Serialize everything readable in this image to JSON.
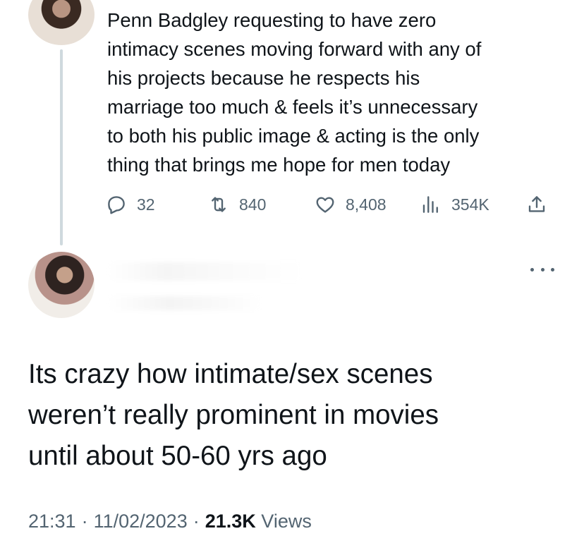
{
  "parent_tweet": {
    "text": "Penn Badgley requesting to have zero\nintimacy scenes moving forward with any of\nhis projects because he respects his\nmarriage too much & feels it’s unnecessary\nto both his public image & acting is the only\nthing that brings me hope for men today",
    "replies": "32",
    "retweets": "840",
    "likes": "8,408",
    "views": "354K"
  },
  "reply_tweet": {
    "text": "Its crazy how intimate/sex scenes\nweren’t really prominent in movies\nuntil about 50-60 yrs ago",
    "time": "21:31",
    "date": "11/02/2023",
    "views_count": "21.3K",
    "views_label": "Views",
    "separator": "·"
  },
  "icons": {
    "reply": "reply-icon",
    "retweet": "retweet-icon",
    "like": "like-icon",
    "views": "views-icon",
    "share": "share-icon",
    "more": "more-icon"
  },
  "colors": {
    "text": "#0f1419",
    "secondary": "#536471",
    "thread_line": "#cfd9de"
  }
}
